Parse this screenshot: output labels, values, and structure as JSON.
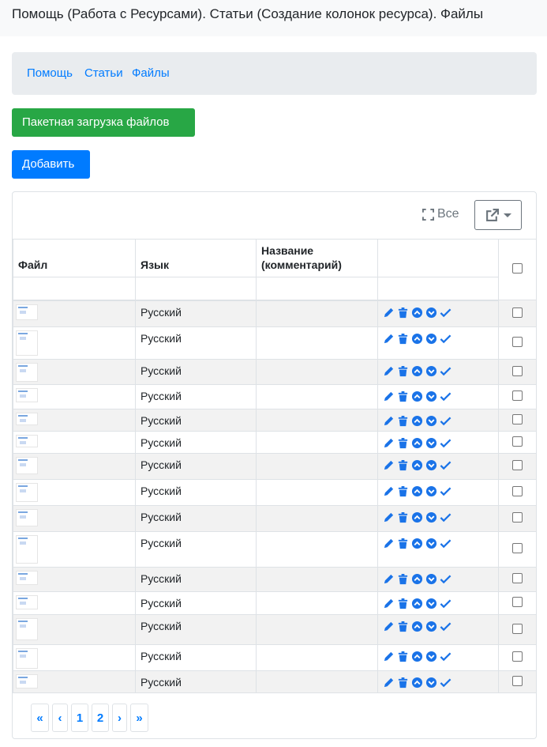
{
  "header": {
    "title": "Помощь (Работа с Ресурсами). Статьи (Создание колонок ресурса). Файлы"
  },
  "breadcrumb": {
    "items": [
      "Помощь",
      "Статьи",
      "Файлы"
    ]
  },
  "toolbar": {
    "batch_upload_label": "Пакетная загрузка файлов",
    "add_label": "Добавить",
    "all_label": "Все"
  },
  "colors": {
    "primary": "#007bff",
    "success": "#28a745",
    "breadcrumb_bg": "#e9ecef",
    "stripe": "#f2f2f2"
  },
  "table": {
    "columns": {
      "file": "Файл",
      "language": "Язык",
      "name": "Название (комментарий)"
    },
    "row_actions": [
      "edit-icon",
      "delete-icon",
      "move-up-icon",
      "move-down-icon",
      "check-icon"
    ],
    "rows": [
      {
        "language": "Русский"
      },
      {
        "language": "Русский"
      },
      {
        "language": "Русский"
      },
      {
        "language": "Русский"
      },
      {
        "language": "Русский"
      },
      {
        "language": "Русский"
      },
      {
        "language": "Русский"
      },
      {
        "language": "Русский"
      },
      {
        "language": "Русский"
      },
      {
        "language": "Русский"
      },
      {
        "language": "Русский"
      },
      {
        "language": "Русский"
      },
      {
        "language": "Русский"
      },
      {
        "language": "Русский"
      },
      {
        "language": "Русский"
      }
    ]
  },
  "pagination": {
    "first": "«",
    "prev": "‹",
    "pages": [
      "1",
      "2"
    ],
    "next": "›",
    "last": "»"
  }
}
